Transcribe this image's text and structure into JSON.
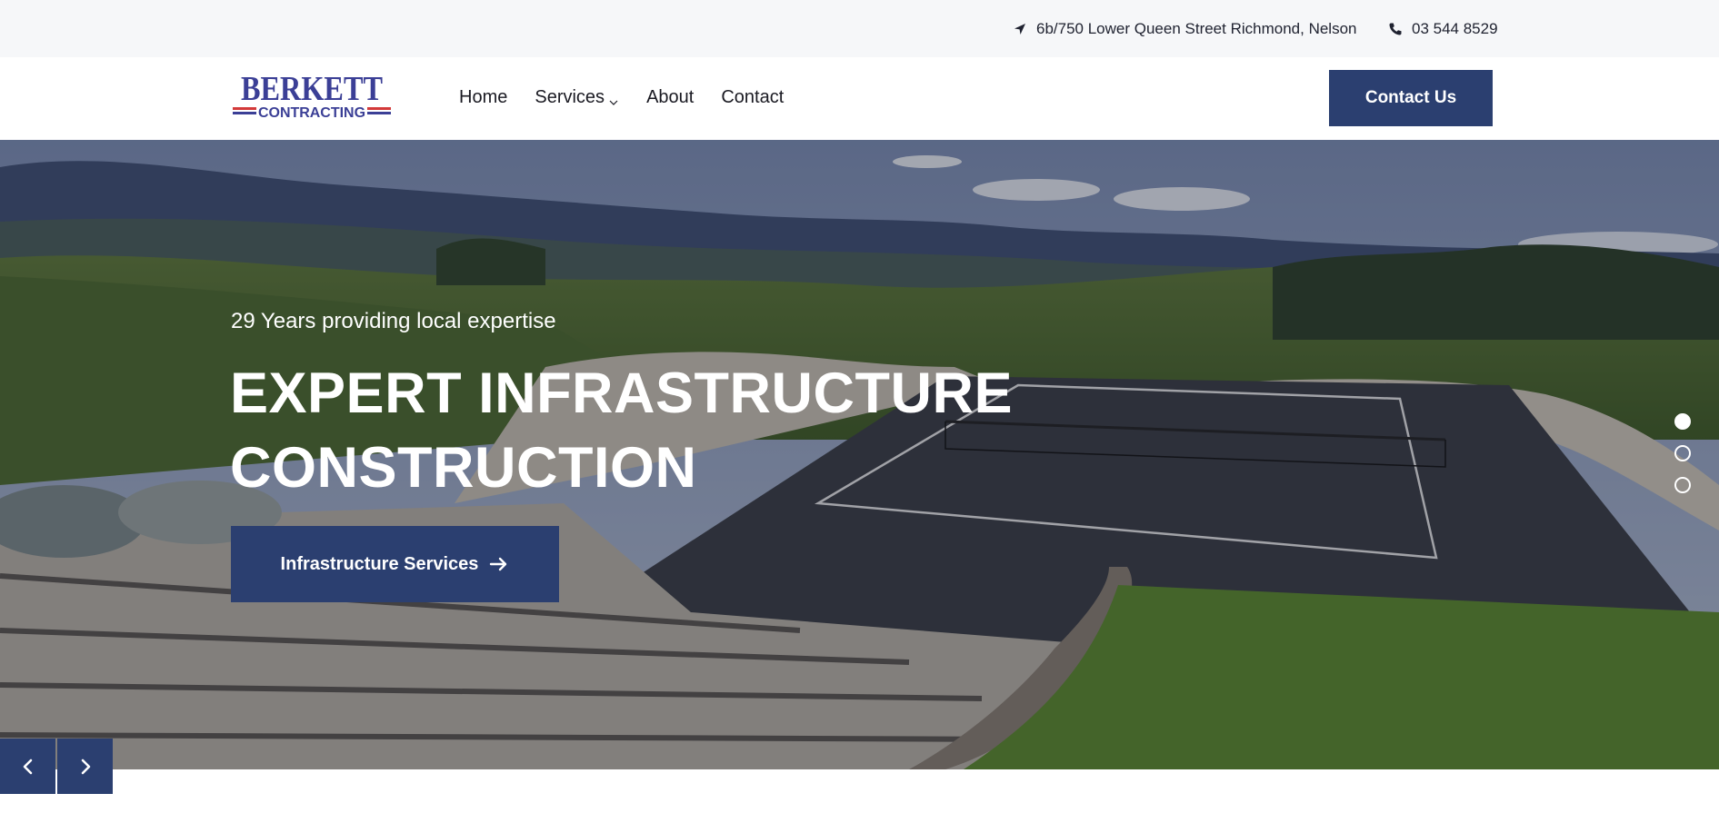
{
  "topbar": {
    "address": "6b/750 Lower Queen Street Richmond, Nelson",
    "address_icon": "location-arrow-icon",
    "phone": "03 544 8529",
    "phone_icon": "phone-icon"
  },
  "header": {
    "logo": {
      "line1": "BERKETT",
      "line2": "CONTRACTING",
      "colors": {
        "primary": "#3b3f96",
        "stripe_red": "#d33a3a"
      }
    },
    "nav": [
      {
        "label": "Home"
      },
      {
        "label": "Services",
        "has_dropdown": true
      },
      {
        "label": "About"
      },
      {
        "label": "Contact"
      }
    ],
    "cta_label": "Contact Us"
  },
  "hero": {
    "kicker": "29 Years providing local expertise",
    "headline_line1": "EXPERT INFRASTRUCTURE",
    "headline_line2": "CONSTRUCTION",
    "button_label": "Infrastructure Services",
    "button_icon": "arrow-right-icon",
    "slides_total": 3,
    "active_slide": 1
  },
  "slider": {
    "prev_icon": "chevron-left-icon",
    "next_icon": "chevron-right-icon"
  },
  "colors": {
    "brand": "#2b3f70",
    "topbar_bg": "#f6f7f9",
    "text_dark": "#1f2230"
  }
}
